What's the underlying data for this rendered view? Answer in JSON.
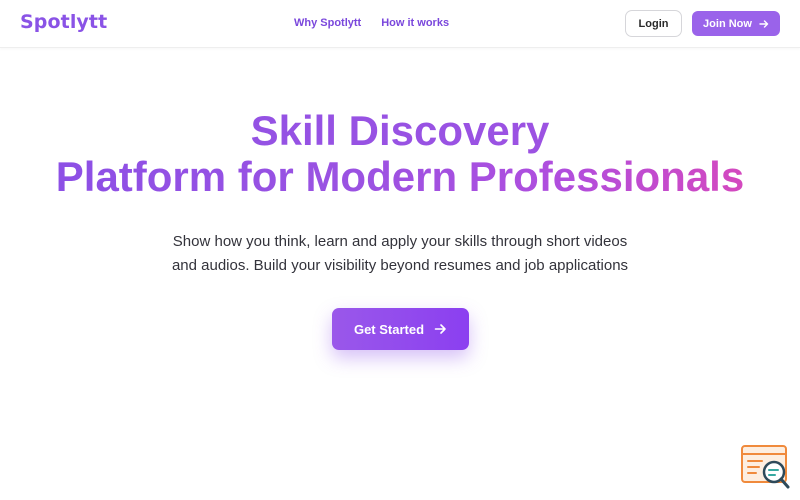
{
  "navbar": {
    "logo": "Spotlytt",
    "links": [
      {
        "label": "Why Spotlytt"
      },
      {
        "label": "How it works"
      }
    ],
    "login_label": "Login",
    "join_label": "Join Now",
    "join_icon": "arrow-right-icon"
  },
  "hero": {
    "title_line1": "Skill Discovery",
    "title_line2": "Platform for Modern Professionals",
    "subtitle_line1": "Show how you think, learn and apply your skills through short videos",
    "subtitle_line2": "and audios. Build your visibility beyond resumes and job applications",
    "cta_label": "Get Started",
    "cta_icon": "arrow-right-icon"
  },
  "corner_widget": {
    "icon": "search-browser-icon"
  },
  "colors": {
    "brand": "#8a53e6",
    "gradient_start": "#8a4fe6",
    "gradient_end": "#df47b5",
    "button_purple": "#9a63ea"
  }
}
